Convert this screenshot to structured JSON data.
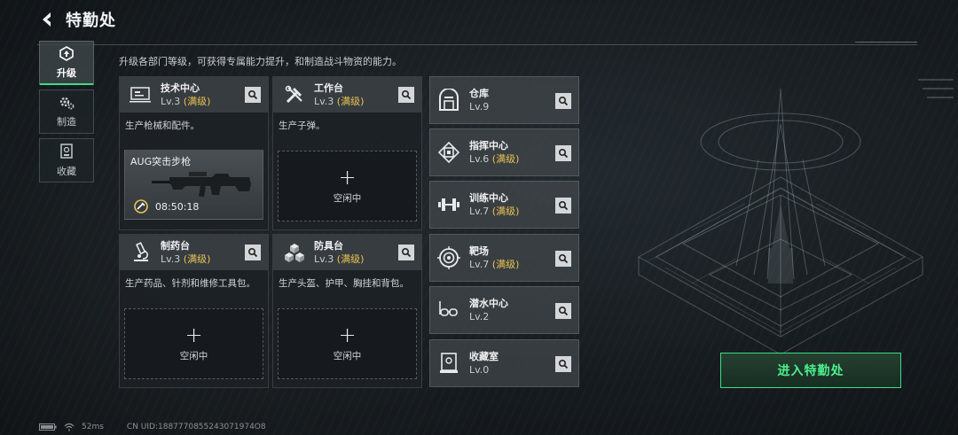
{
  "header": {
    "title": "特勤处"
  },
  "subtitle": "升级各部门等级，可获得专属能力提升，和制造战斗物资的能力。",
  "tabs": [
    {
      "label": "升级",
      "icon": "upgrade-icon",
      "active": true
    },
    {
      "label": "制造",
      "icon": "craft-gear-icon",
      "active": false
    },
    {
      "label": "收藏",
      "icon": "collection-icon",
      "active": false
    }
  ],
  "departments": {
    "tech": {
      "name": "技术中心",
      "level": "Lv.3",
      "max": "(满级)",
      "desc": "生产枪械和配件。",
      "icon": "monitor-icon"
    },
    "workbench": {
      "name": "工作台",
      "level": "Lv.3",
      "max": "(满级)",
      "desc": "生产子弹。",
      "icon": "tools-icon"
    },
    "pharmacy": {
      "name": "制药台",
      "level": "Lv.3",
      "max": "(满级)",
      "desc": "生产药品、针剂和维修工具包。",
      "icon": "microscope-icon"
    },
    "armor": {
      "name": "防具台",
      "level": "Lv.3",
      "max": "(满级)",
      "desc": "生产头盔、护甲、胸挂和背包。",
      "icon": "cubes-icon"
    }
  },
  "crafting": {
    "item_name": "AUG突击步枪",
    "timer": "08:50:18"
  },
  "idle_slot": {
    "plus": "+",
    "label": "空闲中"
  },
  "side_departments": [
    {
      "name": "仓库",
      "level": "Lv.9",
      "max": "",
      "icon": "warehouse-icon"
    },
    {
      "name": "指挥中心",
      "level": "Lv.6",
      "max": "(满级)",
      "icon": "command-chip-icon"
    },
    {
      "name": "训练中心",
      "level": "Lv.7",
      "max": "(满级)",
      "icon": "dumbbell-icon"
    },
    {
      "name": "靶场",
      "level": "Lv.7",
      "max": "(满级)",
      "icon": "target-icon"
    },
    {
      "name": "潜水中心",
      "level": "Lv.2",
      "max": "",
      "icon": "diving-mask-icon"
    },
    {
      "name": "收藏室",
      "level": "Lv.0",
      "max": "",
      "icon": "display-case-icon"
    }
  ],
  "enter_button": "进入特勤处",
  "footer": {
    "ping": "52ms",
    "uid": "CN UID:1887770855243071974O8"
  },
  "colors": {
    "accent_green": "#3ddc84",
    "max_level_gold": "#e8c451"
  }
}
